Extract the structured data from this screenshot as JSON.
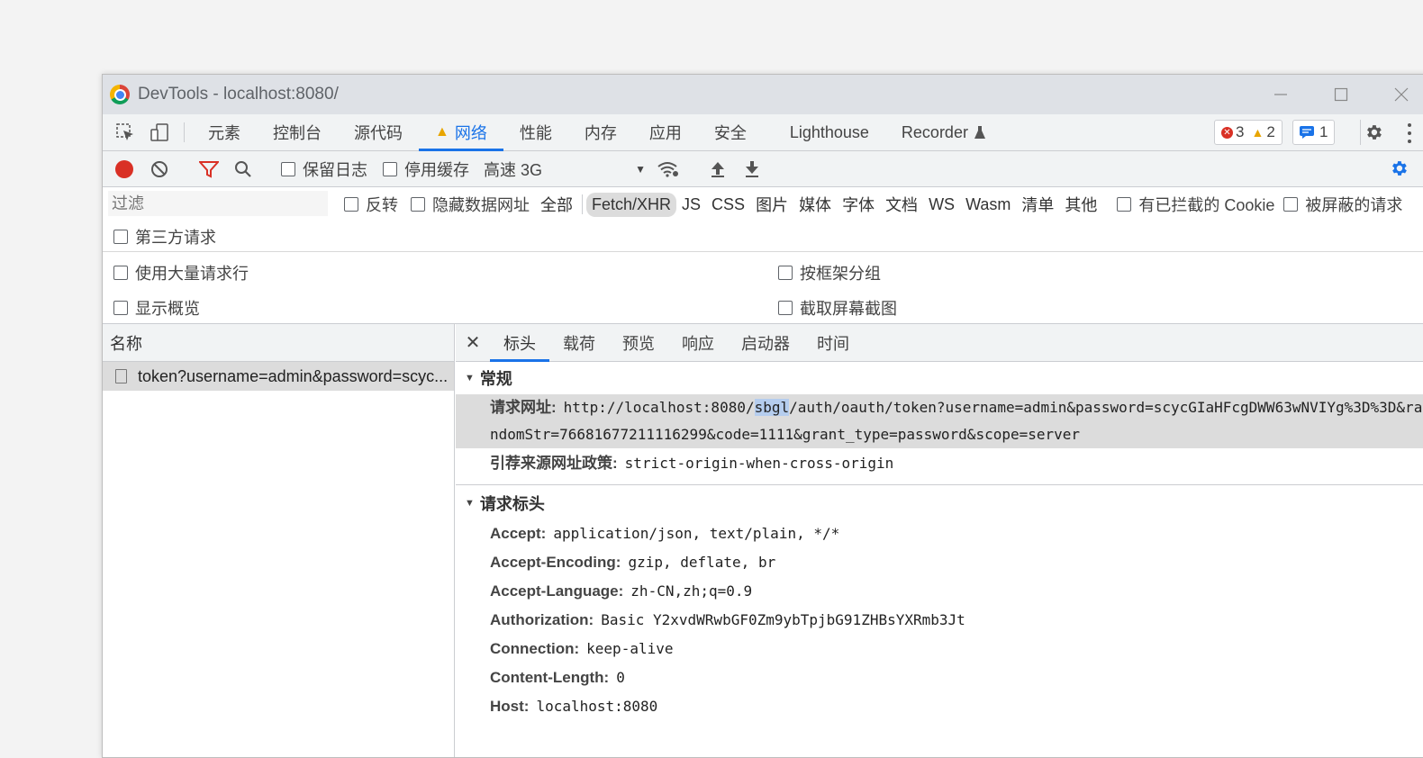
{
  "window": {
    "title": "DevTools - localhost:8080/"
  },
  "main_tabs": [
    "元素",
    "控制台",
    "源代码",
    "网络",
    "性能",
    "内存",
    "应用",
    "安全",
    "Lighthouse",
    "Recorder"
  ],
  "counters": {
    "errors": "3",
    "warnings": "2",
    "messages": "1"
  },
  "toolbar": {
    "preserve_log": "保留日志",
    "disable_cache": "停用缓存",
    "throttle": "高速 3G"
  },
  "filter": {
    "placeholder": "过滤",
    "invert": "反转",
    "hide_data_urls": "隐藏数据网址",
    "types": [
      "全部",
      "Fetch/XHR",
      "JS",
      "CSS",
      "图片",
      "媒体",
      "字体",
      "文档",
      "WS",
      "Wasm",
      "清单",
      "其他"
    ],
    "selected_type": "Fetch/XHR",
    "blocked_cookies": "有已拦截的 Cookie",
    "blocked_requests": "被屏蔽的请求",
    "third_party": "第三方请求"
  },
  "settings": {
    "large_rows": "使用大量请求行",
    "group_by_frame": "按框架分组",
    "show_overview": "显示概览",
    "capture_screenshots": "截取屏幕截图"
  },
  "request_list": {
    "header": "名称",
    "rows": [
      "token?username=admin&password=scyc..."
    ]
  },
  "detail_tabs": [
    "标头",
    "载荷",
    "预览",
    "响应",
    "启动器",
    "时间"
  ],
  "general": {
    "title": "常规",
    "request_url_label": "请求网址:",
    "request_url_pre": "http://localhost:8080/",
    "request_url_sel": "sbgl",
    "request_url_post": "/auth/oauth/token?username=admin&password=scycGIaHFcgDWW63wNVIYg%3D%3D&randomStr=76681677211116299&code=1111&grant_type=password&scope=server",
    "referrer_label": "引荐来源网址政策:",
    "referrer_value": "strict-origin-when-cross-origin"
  },
  "request_headers": {
    "title": "请求标头",
    "items": [
      {
        "name": "Accept:",
        "value": "application/json, text/plain, */*"
      },
      {
        "name": "Accept-Encoding:",
        "value": "gzip, deflate, br"
      },
      {
        "name": "Accept-Language:",
        "value": "zh-CN,zh;q=0.9"
      },
      {
        "name": "Authorization:",
        "value": "Basic Y2xvdWRwbGF0Zm9ybTpjbG91ZHBsYXRmb3Jt"
      },
      {
        "name": "Connection:",
        "value": "keep-alive"
      },
      {
        "name": "Content-Length:",
        "value": "0"
      },
      {
        "name": "Host:",
        "value": "localhost:8080"
      }
    ]
  }
}
